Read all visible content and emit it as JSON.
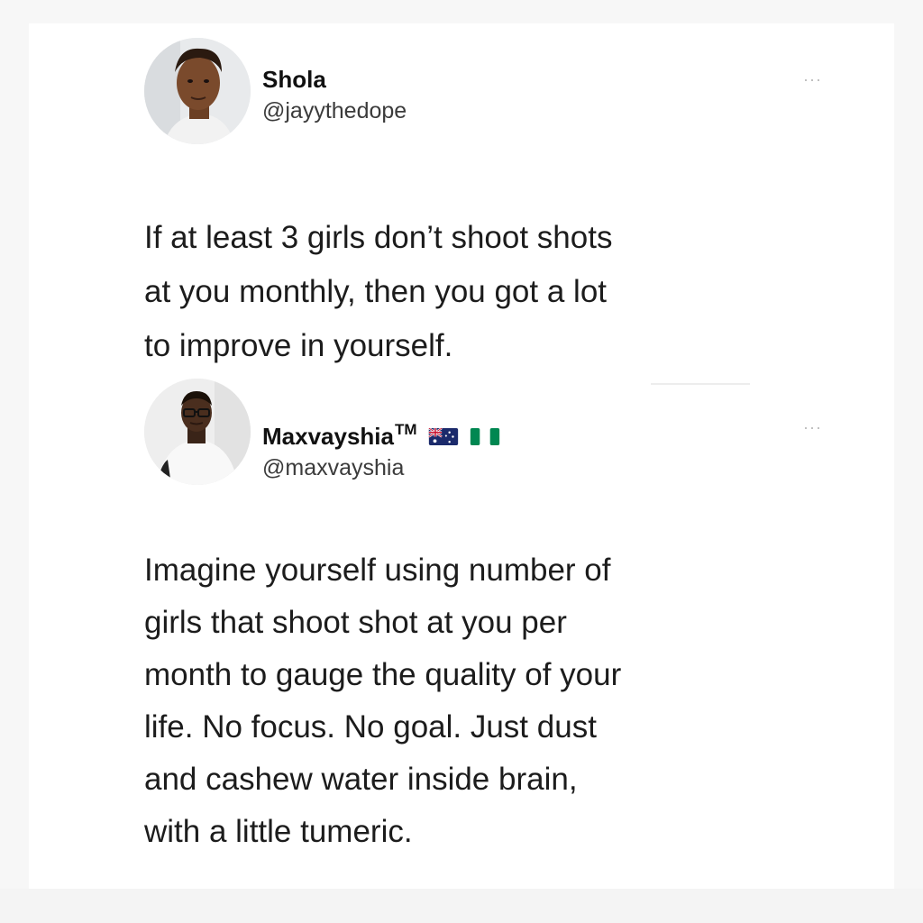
{
  "tweets": [
    {
      "display_name": "Shola",
      "handle": "@jayythedope",
      "more_label": "···",
      "text": "If at least 3 girls don’t shoot shots\nat you monthly, then you got a lot\nto improve in yourself."
    },
    {
      "display_name": "Maxvayshia",
      "trademark": "TM",
      "handle": "@maxvayshia",
      "more_label": "···",
      "flags": [
        "australia-flag",
        "nigeria-flag"
      ],
      "text": "Imagine yourself using number of\ngirls that shoot shot at you per\nmonth to gauge the quality of your\nlife. No focus. No goal. Just dust\nand cashew water inside brain,\nwith a little tumeric."
    }
  ],
  "colors": {
    "background": "#f7f7f7",
    "card": "#ffffff",
    "text": "#1c1c1c",
    "handle": "#3b3b3b",
    "more": "#b7b7b7",
    "nigeria_green": "#008751"
  }
}
